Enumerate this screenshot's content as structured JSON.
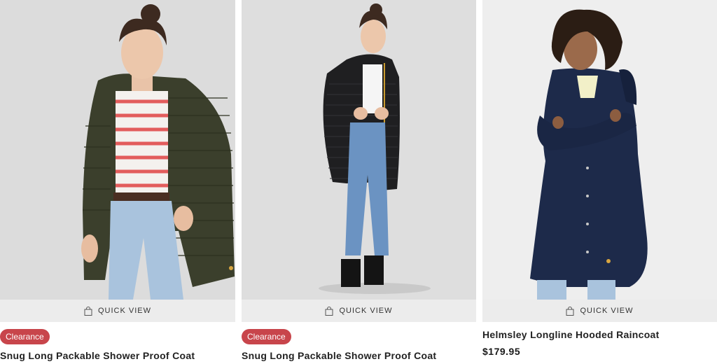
{
  "products": [
    {
      "badge": "Clearance",
      "quick_view": "QUICK VIEW",
      "title": "Snug Long Packable Shower Proof Coat",
      "image_desc": "woman-in-khaki-quilted-coat"
    },
    {
      "badge": "Clearance",
      "quick_view": "QUICK VIEW",
      "title": "Snug Long Packable Shower Proof Coat",
      "image_desc": "woman-in-black-quilted-coat"
    },
    {
      "quick_view": "QUICK VIEW",
      "title": "Helmsley Longline Hooded Raincoat",
      "price": "$179.95",
      "image_desc": "woman-in-navy-raincoat"
    }
  ],
  "colors": {
    "badge": "#c8454b",
    "quick_view_bg": "#ececec",
    "khaki_coat": "#3b3f2c",
    "black_coat": "#1f1f21",
    "navy_coat": "#1d2a4a"
  }
}
